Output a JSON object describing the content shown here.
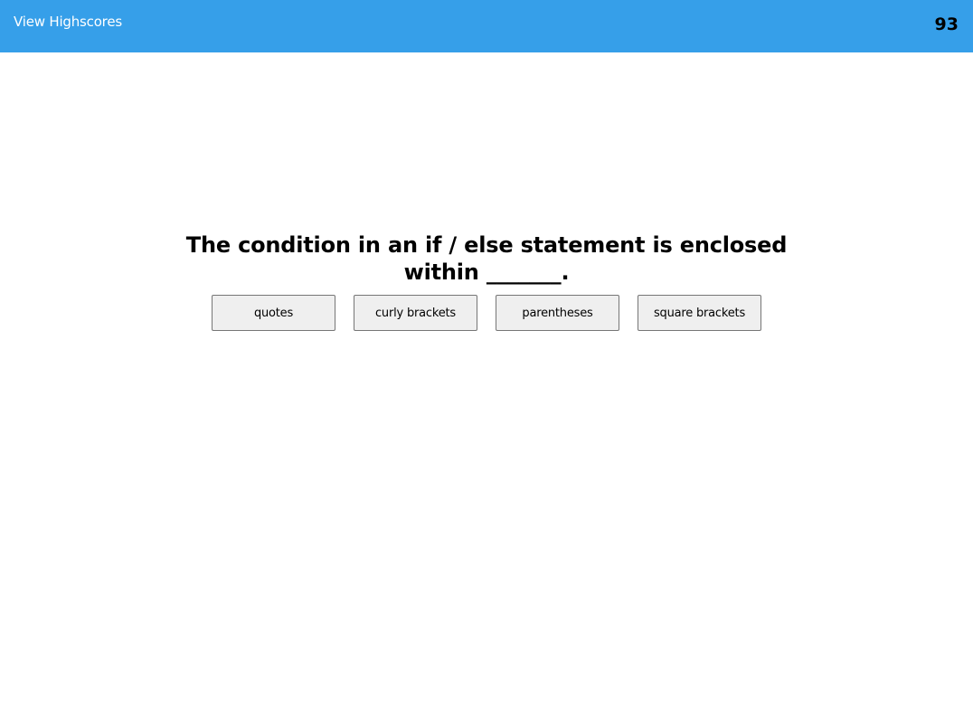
{
  "header": {
    "highscores_label": "View Highscores",
    "timer_value": "93",
    "bg_color": "#369fe9"
  },
  "quiz": {
    "question": "The condition in an if / else statement is enclosed within _______.",
    "answers": [
      "quotes",
      "curly brackets",
      "parentheses",
      "square brackets"
    ]
  }
}
